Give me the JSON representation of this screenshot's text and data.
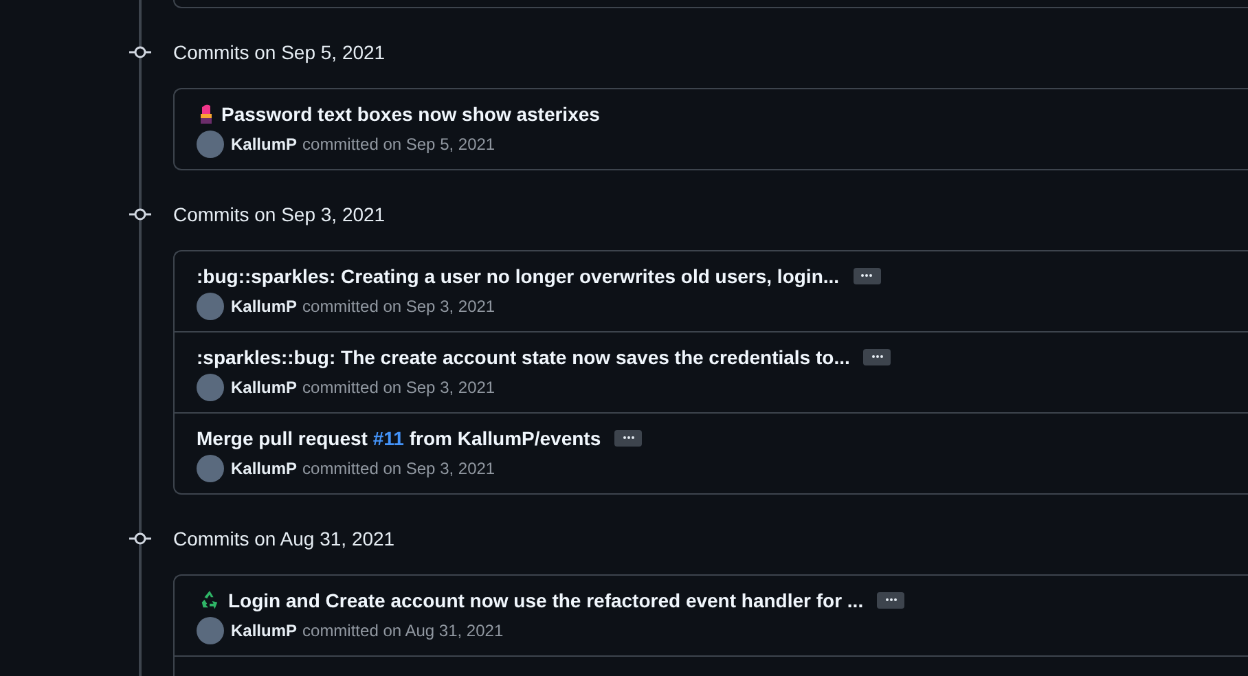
{
  "groups": [
    {
      "heading": "Commits on Sep 5, 2021",
      "commits": [
        {
          "kind": "lipstick",
          "title_parts": [
            {
              "kind": "text",
              "text": "Password text boxes now show asterixes"
            }
          ],
          "author": "KallumP",
          "meta": "committed on Sep 5, 2021",
          "more": false
        }
      ]
    },
    {
      "heading": "Commits on Sep 3, 2021",
      "commits": [
        {
          "kind": "plain",
          "title_parts": [
            {
              "kind": "text",
              "text": ":bug::sparkles: Creating a user no longer overwrites old users, login..."
            }
          ],
          "author": "KallumP",
          "meta": "committed on Sep 3, 2021",
          "more": true
        },
        {
          "kind": "plain",
          "title_parts": [
            {
              "kind": "text",
              "text": ":sparkles::bug: The create account state now saves the credentials to..."
            }
          ],
          "author": "KallumP",
          "meta": "committed on Sep 3, 2021",
          "more": true
        },
        {
          "kind": "plain",
          "title_parts": [
            {
              "kind": "text",
              "text": "Merge pull request "
            },
            {
              "kind": "link",
              "text": "#11"
            },
            {
              "kind": "text",
              "text": " from KallumP/events"
            }
          ],
          "author": "KallumP",
          "meta": "committed on Sep 3, 2021",
          "more": true
        }
      ]
    },
    {
      "heading": "Commits on Aug 31, 2021",
      "commits": [
        {
          "kind": "recycle",
          "title_parts": [
            {
              "kind": "text",
              "text": "Login and Create account now use the refactored event handler for ..."
            }
          ],
          "author": "KallumP",
          "meta": "committed on Aug 31, 2021",
          "more": true
        }
      ]
    }
  ]
}
